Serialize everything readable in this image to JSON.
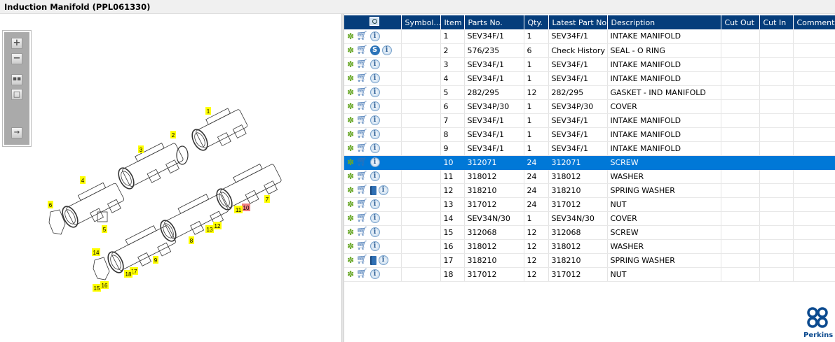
{
  "title": "Induction Manifold (PPL061330)",
  "toolbar": {
    "zoom_in": "zoom-in",
    "zoom_out": "zoom-out",
    "fit": "fit-all",
    "window": "reset-view",
    "export": "export"
  },
  "diagram": {
    "labels": [
      {
        "text": "1",
        "hl": "yellow"
      },
      {
        "text": "2",
        "hl": "yellow"
      },
      {
        "text": "3",
        "hl": "yellow"
      },
      {
        "text": "4",
        "hl": "yellow"
      },
      {
        "text": "5",
        "hl": "yellow"
      },
      {
        "text": "6",
        "hl": "yellow"
      },
      {
        "text": "7",
        "hl": "yellow"
      },
      {
        "text": "8",
        "hl": "yellow"
      },
      {
        "text": "9",
        "hl": "yellow"
      },
      {
        "text": "10",
        "hl": "red"
      },
      {
        "text": "11",
        "hl": "yellow"
      },
      {
        "text": "12",
        "hl": "yellow"
      },
      {
        "text": "13",
        "hl": "yellow"
      },
      {
        "text": "14",
        "hl": "yellow"
      },
      {
        "text": "15",
        "hl": "yellow"
      },
      {
        "text": "16",
        "hl": "yellow"
      },
      {
        "text": "17",
        "hl": "yellow"
      },
      {
        "text": "18",
        "hl": "yellow"
      }
    ]
  },
  "columns": [
    "",
    "Symbol...",
    "Item",
    "Parts No.",
    "Qty.",
    "Latest Part No.",
    "Description",
    "Cut Out",
    "Cut In",
    "Comment"
  ],
  "rows": [
    {
      "icons": [
        "gear",
        "cart",
        "info"
      ],
      "item": "1",
      "parts_no": "SEV34F/1",
      "qty": "1",
      "latest": "SEV34F/1",
      "desc": "INTAKE MANIFOLD"
    },
    {
      "icons": [
        "gear",
        "cart",
        "s",
        "info"
      ],
      "item": "2",
      "parts_no": "576/235",
      "qty": "6",
      "latest": "Check History",
      "desc": "SEAL - O RING"
    },
    {
      "icons": [
        "gear",
        "cart",
        "info"
      ],
      "item": "3",
      "parts_no": "SEV34F/1",
      "qty": "1",
      "latest": "SEV34F/1",
      "desc": "INTAKE MANIFOLD"
    },
    {
      "icons": [
        "gear",
        "cart",
        "info"
      ],
      "item": "4",
      "parts_no": "SEV34F/1",
      "qty": "1",
      "latest": "SEV34F/1",
      "desc": "INTAKE MANIFOLD"
    },
    {
      "icons": [
        "gear",
        "cart",
        "info"
      ],
      "item": "5",
      "parts_no": "282/295",
      "qty": "12",
      "latest": "282/295",
      "desc": "GASKET - IND MANIFOLD"
    },
    {
      "icons": [
        "gear",
        "cart",
        "info"
      ],
      "item": "6",
      "parts_no": "SEV34P/30",
      "qty": "1",
      "latest": "SEV34P/30",
      "desc": "COVER"
    },
    {
      "icons": [
        "gear",
        "cart",
        "info"
      ],
      "item": "7",
      "parts_no": "SEV34F/1",
      "qty": "1",
      "latest": "SEV34F/1",
      "desc": "INTAKE MANIFOLD"
    },
    {
      "icons": [
        "gear",
        "cart",
        "info"
      ],
      "item": "8",
      "parts_no": "SEV34F/1",
      "qty": "1",
      "latest": "SEV34F/1",
      "desc": "INTAKE MANIFOLD"
    },
    {
      "icons": [
        "gear",
        "cart",
        "info"
      ],
      "item": "9",
      "parts_no": "SEV34F/1",
      "qty": "1",
      "latest": "SEV34F/1",
      "desc": "INTAKE MANIFOLD"
    },
    {
      "icons": [
        "gear",
        "cart",
        "info"
      ],
      "item": "10",
      "parts_no": "312071",
      "qty": "24",
      "latest": "312071",
      "desc": "SCREW",
      "selected": true
    },
    {
      "icons": [
        "gear",
        "cart",
        "info"
      ],
      "item": "11",
      "parts_no": "318012",
      "qty": "24",
      "latest": "318012",
      "desc": "WASHER"
    },
    {
      "icons": [
        "gear",
        "cart",
        "book",
        "info"
      ],
      "item": "12",
      "parts_no": "318210",
      "qty": "24",
      "latest": "318210",
      "desc": "SPRING WASHER"
    },
    {
      "icons": [
        "gear",
        "cart",
        "info"
      ],
      "item": "13",
      "parts_no": "317012",
      "qty": "24",
      "latest": "317012",
      "desc": "NUT"
    },
    {
      "icons": [
        "gear",
        "cart",
        "info"
      ],
      "item": "14",
      "parts_no": "SEV34N/30",
      "qty": "1",
      "latest": "SEV34N/30",
      "desc": "COVER"
    },
    {
      "icons": [
        "gear",
        "cart",
        "info"
      ],
      "item": "15",
      "parts_no": "312068",
      "qty": "12",
      "latest": "312068",
      "desc": "SCREW"
    },
    {
      "icons": [
        "gear",
        "cart",
        "info"
      ],
      "item": "16",
      "parts_no": "318012",
      "qty": "12",
      "latest": "318012",
      "desc": "WASHER"
    },
    {
      "icons": [
        "gear",
        "cart",
        "book",
        "info"
      ],
      "item": "17",
      "parts_no": "318210",
      "qty": "12",
      "latest": "318210",
      "desc": "SPRING WASHER"
    },
    {
      "icons": [
        "gear",
        "cart",
        "info"
      ],
      "item": "18",
      "parts_no": "317012",
      "qty": "12",
      "latest": "317012",
      "desc": "NUT"
    }
  ],
  "logo": {
    "text": "Perkins"
  },
  "colors": {
    "header": "#053d7b",
    "selected": "#0078d7",
    "highlight": "#ffff00",
    "highlight_selected": "#f08080"
  }
}
